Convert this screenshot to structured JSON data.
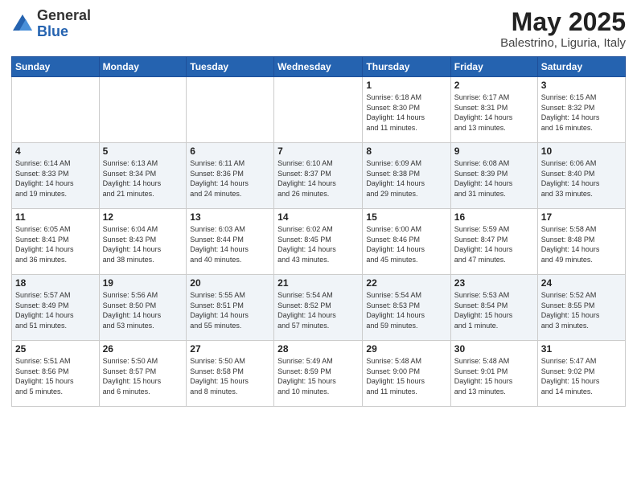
{
  "logo": {
    "general": "General",
    "blue": "Blue"
  },
  "title": {
    "month": "May 2025",
    "location": "Balestrino, Liguria, Italy"
  },
  "weekdays": [
    "Sunday",
    "Monday",
    "Tuesday",
    "Wednesday",
    "Thursday",
    "Friday",
    "Saturday"
  ],
  "weeks": [
    [
      {
        "day": "",
        "info": ""
      },
      {
        "day": "",
        "info": ""
      },
      {
        "day": "",
        "info": ""
      },
      {
        "day": "",
        "info": ""
      },
      {
        "day": "1",
        "info": "Sunrise: 6:18 AM\nSunset: 8:30 PM\nDaylight: 14 hours\nand 11 minutes."
      },
      {
        "day": "2",
        "info": "Sunrise: 6:17 AM\nSunset: 8:31 PM\nDaylight: 14 hours\nand 13 minutes."
      },
      {
        "day": "3",
        "info": "Sunrise: 6:15 AM\nSunset: 8:32 PM\nDaylight: 14 hours\nand 16 minutes."
      }
    ],
    [
      {
        "day": "4",
        "info": "Sunrise: 6:14 AM\nSunset: 8:33 PM\nDaylight: 14 hours\nand 19 minutes."
      },
      {
        "day": "5",
        "info": "Sunrise: 6:13 AM\nSunset: 8:34 PM\nDaylight: 14 hours\nand 21 minutes."
      },
      {
        "day": "6",
        "info": "Sunrise: 6:11 AM\nSunset: 8:36 PM\nDaylight: 14 hours\nand 24 minutes."
      },
      {
        "day": "7",
        "info": "Sunrise: 6:10 AM\nSunset: 8:37 PM\nDaylight: 14 hours\nand 26 minutes."
      },
      {
        "day": "8",
        "info": "Sunrise: 6:09 AM\nSunset: 8:38 PM\nDaylight: 14 hours\nand 29 minutes."
      },
      {
        "day": "9",
        "info": "Sunrise: 6:08 AM\nSunset: 8:39 PM\nDaylight: 14 hours\nand 31 minutes."
      },
      {
        "day": "10",
        "info": "Sunrise: 6:06 AM\nSunset: 8:40 PM\nDaylight: 14 hours\nand 33 minutes."
      }
    ],
    [
      {
        "day": "11",
        "info": "Sunrise: 6:05 AM\nSunset: 8:41 PM\nDaylight: 14 hours\nand 36 minutes."
      },
      {
        "day": "12",
        "info": "Sunrise: 6:04 AM\nSunset: 8:43 PM\nDaylight: 14 hours\nand 38 minutes."
      },
      {
        "day": "13",
        "info": "Sunrise: 6:03 AM\nSunset: 8:44 PM\nDaylight: 14 hours\nand 40 minutes."
      },
      {
        "day": "14",
        "info": "Sunrise: 6:02 AM\nSunset: 8:45 PM\nDaylight: 14 hours\nand 43 minutes."
      },
      {
        "day": "15",
        "info": "Sunrise: 6:00 AM\nSunset: 8:46 PM\nDaylight: 14 hours\nand 45 minutes."
      },
      {
        "day": "16",
        "info": "Sunrise: 5:59 AM\nSunset: 8:47 PM\nDaylight: 14 hours\nand 47 minutes."
      },
      {
        "day": "17",
        "info": "Sunrise: 5:58 AM\nSunset: 8:48 PM\nDaylight: 14 hours\nand 49 minutes."
      }
    ],
    [
      {
        "day": "18",
        "info": "Sunrise: 5:57 AM\nSunset: 8:49 PM\nDaylight: 14 hours\nand 51 minutes."
      },
      {
        "day": "19",
        "info": "Sunrise: 5:56 AM\nSunset: 8:50 PM\nDaylight: 14 hours\nand 53 minutes."
      },
      {
        "day": "20",
        "info": "Sunrise: 5:55 AM\nSunset: 8:51 PM\nDaylight: 14 hours\nand 55 minutes."
      },
      {
        "day": "21",
        "info": "Sunrise: 5:54 AM\nSunset: 8:52 PM\nDaylight: 14 hours\nand 57 minutes."
      },
      {
        "day": "22",
        "info": "Sunrise: 5:54 AM\nSunset: 8:53 PM\nDaylight: 14 hours\nand 59 minutes."
      },
      {
        "day": "23",
        "info": "Sunrise: 5:53 AM\nSunset: 8:54 PM\nDaylight: 15 hours\nand 1 minute."
      },
      {
        "day": "24",
        "info": "Sunrise: 5:52 AM\nSunset: 8:55 PM\nDaylight: 15 hours\nand 3 minutes."
      }
    ],
    [
      {
        "day": "25",
        "info": "Sunrise: 5:51 AM\nSunset: 8:56 PM\nDaylight: 15 hours\nand 5 minutes."
      },
      {
        "day": "26",
        "info": "Sunrise: 5:50 AM\nSunset: 8:57 PM\nDaylight: 15 hours\nand 6 minutes."
      },
      {
        "day": "27",
        "info": "Sunrise: 5:50 AM\nSunset: 8:58 PM\nDaylight: 15 hours\nand 8 minutes."
      },
      {
        "day": "28",
        "info": "Sunrise: 5:49 AM\nSunset: 8:59 PM\nDaylight: 15 hours\nand 10 minutes."
      },
      {
        "day": "29",
        "info": "Sunrise: 5:48 AM\nSunset: 9:00 PM\nDaylight: 15 hours\nand 11 minutes."
      },
      {
        "day": "30",
        "info": "Sunrise: 5:48 AM\nSunset: 9:01 PM\nDaylight: 15 hours\nand 13 minutes."
      },
      {
        "day": "31",
        "info": "Sunrise: 5:47 AM\nSunset: 9:02 PM\nDaylight: 15 hours\nand 14 minutes."
      }
    ]
  ]
}
